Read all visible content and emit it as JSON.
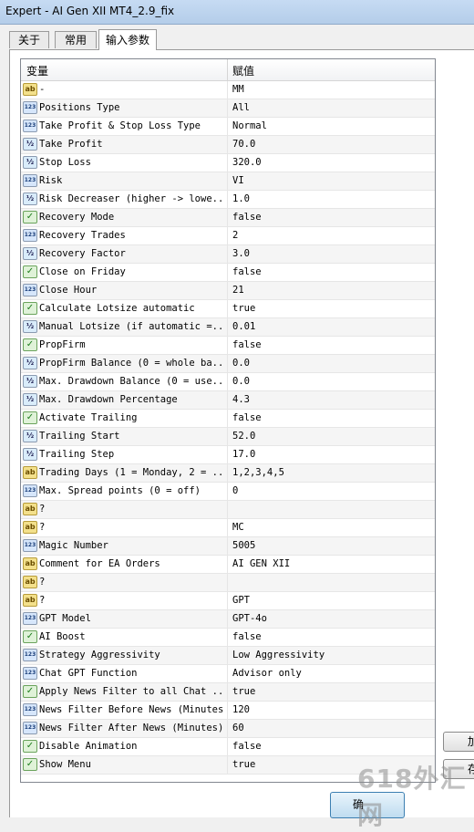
{
  "window": {
    "title": "Expert - AI Gen XII MT4_2.9_fix"
  },
  "tabs": [
    {
      "label": "关于"
    },
    {
      "label": "常用"
    },
    {
      "label": "输入参数"
    }
  ],
  "grid": {
    "header": {
      "variable": "变量",
      "value": "赋值"
    },
    "rows": [
      {
        "icon": "ab",
        "name": "-",
        "value": " MM"
      },
      {
        "icon": "123",
        "name": "Positions Type",
        "value": "All"
      },
      {
        "icon": "123",
        "name": "Take Profit & Stop Loss Type",
        "value": "Normal"
      },
      {
        "icon": "1/2",
        "name": "Take Profit",
        "value": "70.0"
      },
      {
        "icon": "1/2",
        "name": "Stop Loss",
        "value": "320.0"
      },
      {
        "icon": "123",
        "name": "Risk",
        "value": "VI"
      },
      {
        "icon": "1/2",
        "name": "Risk Decreaser (higher -> lowe...",
        "value": "1.0"
      },
      {
        "icon": "bool",
        "name": "Recovery Mode",
        "value": "false"
      },
      {
        "icon": "123",
        "name": "Recovery Trades",
        "value": "2"
      },
      {
        "icon": "1/2",
        "name": "Recovery Factor",
        "value": "3.0"
      },
      {
        "icon": "bool",
        "name": "Close on Friday",
        "value": "false"
      },
      {
        "icon": "123",
        "name": "Close Hour",
        "value": "21"
      },
      {
        "icon": "bool",
        "name": "Calculate Lotsize automatic",
        "value": "true"
      },
      {
        "icon": "1/2",
        "name": "Manual Lotsize (if automatic =...",
        "value": "0.01"
      },
      {
        "icon": "bool",
        "name": "PropFirm",
        "value": "false"
      },
      {
        "icon": "1/2",
        "name": "PropFirm Balance (0 = whole ba...",
        "value": "0.0"
      },
      {
        "icon": "1/2",
        "name": "Max. Drawdown Balance (0 = use...",
        "value": "0.0"
      },
      {
        "icon": "1/2",
        "name": "Max. Drawdown Percentage",
        "value": "4.3"
      },
      {
        "icon": "bool",
        "name": "Activate Trailing",
        "value": "false"
      },
      {
        "icon": "1/2",
        "name": "Trailing Start",
        "value": "52.0"
      },
      {
        "icon": "1/2",
        "name": "Trailing Step",
        "value": "17.0"
      },
      {
        "icon": "ab",
        "name": "Trading Days (1 = Monday, 2 = ...",
        "value": "1,2,3,4,5"
      },
      {
        "icon": "123",
        "name": "Max. Spread points (0 = off)",
        "value": "0"
      },
      {
        "icon": "ab",
        "name": "?",
        "value": ""
      },
      {
        "icon": "ab",
        "name": "?",
        "value": " MC"
      },
      {
        "icon": "123",
        "name": "Magic Number",
        "value": "5005"
      },
      {
        "icon": "ab",
        "name": "Comment for EA Orders",
        "value": "AI GEN XII"
      },
      {
        "icon": "ab",
        "name": "?",
        "value": ""
      },
      {
        "icon": "ab",
        "name": "?",
        "value": " GPT"
      },
      {
        "icon": "123",
        "name": "GPT Model",
        "value": "GPT-4o"
      },
      {
        "icon": "bool",
        "name": "AI Boost",
        "value": "false"
      },
      {
        "icon": "123",
        "name": "Strategy Aggressivity",
        "value": "Low Aggressivity"
      },
      {
        "icon": "123",
        "name": "Chat GPT Function",
        "value": "Advisor only"
      },
      {
        "icon": "bool",
        "name": "Apply News Filter to all Chat ...",
        "value": "true"
      },
      {
        "icon": "123",
        "name": "News Filter Before News (Minutes)",
        "value": "120"
      },
      {
        "icon": "123",
        "name": "News Filter After News (Minutes)",
        "value": "60"
      },
      {
        "icon": "bool",
        "name": "Disable Animation",
        "value": "false"
      },
      {
        "icon": "bool",
        "name": "Show Menu",
        "value": "true"
      }
    ]
  },
  "buttons": {
    "side1": "加",
    "side2": "存",
    "ok": "确"
  },
  "watermark": "618外汇网",
  "icon_glyphs": {
    "ab": "ab",
    "123": "123",
    "1/2": "½",
    "bool": "✓"
  },
  "colors": {
    "title_bar": "#c6dbf3",
    "grid_border": "#828790"
  }
}
